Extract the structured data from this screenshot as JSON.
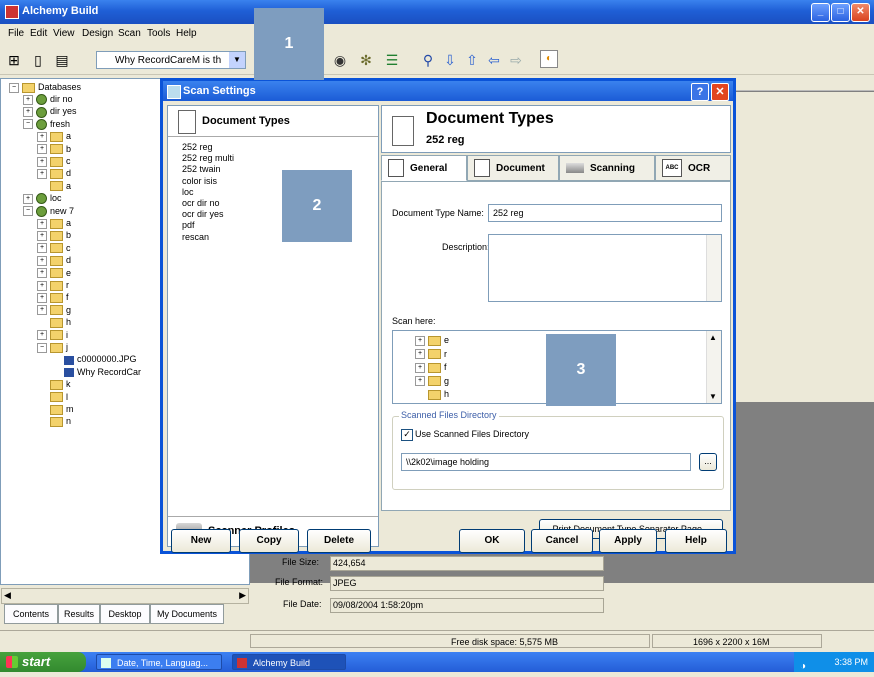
{
  "app": {
    "title": "Alchemy Build",
    "menus": [
      "File",
      "Edit",
      "View",
      "Design",
      "Scan",
      "Tools",
      "Help"
    ],
    "toolbar_combo_value": "Why RecordCareM is th",
    "tree": {
      "root": "Databases",
      "items": [
        {
          "label": "dir no",
          "indent": 1,
          "kind": "db",
          "exp": "+"
        },
        {
          "label": "dir yes",
          "indent": 1,
          "kind": "db",
          "exp": "+"
        },
        {
          "label": "fresh",
          "indent": 1,
          "kind": "db",
          "exp": "−"
        },
        {
          "label": "a",
          "indent": 2,
          "kind": "folder",
          "exp": "+"
        },
        {
          "label": "b",
          "indent": 2,
          "kind": "folder",
          "exp": "+"
        },
        {
          "label": "c",
          "indent": 2,
          "kind": "folder",
          "exp": "+"
        },
        {
          "label": "d",
          "indent": 2,
          "kind": "folder",
          "exp": "+"
        },
        {
          "label": "a",
          "indent": 2,
          "kind": "folder",
          "exp": ""
        },
        {
          "label": "loc",
          "indent": 1,
          "kind": "db",
          "exp": "+"
        },
        {
          "label": "new 7",
          "indent": 1,
          "kind": "db",
          "exp": "−"
        },
        {
          "label": "a",
          "indent": 2,
          "kind": "folder",
          "exp": "+"
        },
        {
          "label": "b",
          "indent": 2,
          "kind": "folder",
          "exp": "+"
        },
        {
          "label": "c",
          "indent": 2,
          "kind": "folder",
          "exp": "+"
        },
        {
          "label": "d",
          "indent": 2,
          "kind": "folder",
          "exp": "+"
        },
        {
          "label": "e",
          "indent": 2,
          "kind": "folder",
          "exp": "+"
        },
        {
          "label": "r",
          "indent": 2,
          "kind": "folder",
          "exp": "+"
        },
        {
          "label": "f",
          "indent": 2,
          "kind": "folder",
          "exp": "+"
        },
        {
          "label": "g",
          "indent": 2,
          "kind": "folder",
          "exp": "+"
        },
        {
          "label": "h",
          "indent": 2,
          "kind": "folder",
          "exp": ""
        },
        {
          "label": "i",
          "indent": 2,
          "kind": "folder",
          "exp": "+"
        },
        {
          "label": "j",
          "indent": 2,
          "kind": "folder",
          "exp": "−"
        },
        {
          "label": "c0000000.JPG",
          "indent": 3,
          "kind": "file",
          "exp": ""
        },
        {
          "label": "Why RecordCar",
          "indent": 3,
          "kind": "file",
          "exp": ""
        },
        {
          "label": "k",
          "indent": 2,
          "kind": "folder",
          "exp": ""
        },
        {
          "label": "l",
          "indent": 2,
          "kind": "folder",
          "exp": ""
        },
        {
          "label": "m",
          "indent": 2,
          "kind": "folder",
          "exp": ""
        },
        {
          "label": "n",
          "indent": 2,
          "kind": "folder",
          "exp": ""
        }
      ]
    },
    "bottom_tabs": [
      "Contents",
      "Results",
      "Desktop",
      "My Documents"
    ],
    "file_props": {
      "file_size_label": "File Size:",
      "file_size_value": "424,654",
      "file_format_label": "File Format:",
      "file_format_value": "JPEG",
      "file_date_label": "File Date:",
      "file_date_value": "09/08/2004 1:58:20pm"
    },
    "status": {
      "free_disk": "Free disk space: 5,575 MB",
      "dimensions": "1696 x 2200 x 16M"
    }
  },
  "taskbar": {
    "start_label": "start",
    "tasks": [
      "Date, Time, Languag...",
      "Alchemy Build"
    ],
    "clock": "3:38 PM"
  },
  "dialog": {
    "title": "Scan Settings",
    "help_glyph": "?",
    "close_glyph": "✕",
    "left_header": "Document Types",
    "document_types": [
      "252 reg",
      "252 reg multi",
      "252 twain",
      "color isis",
      "loc",
      "ocr dir no",
      "ocr dir yes",
      "pdf",
      "rescan"
    ],
    "scanner_profiles": "Scanner Profiles",
    "buttons_left": [
      "New",
      "Copy",
      "Delete"
    ],
    "right_header_title": "Document Types",
    "right_header_sub": "252 reg",
    "tabs": [
      "General",
      "Document",
      "Scanning",
      "OCR"
    ],
    "ocr_badge": "ABC",
    "general": {
      "doc_type_name_label": "Document Type Name:",
      "doc_type_name_value": "252 reg",
      "description_label": "Description:",
      "description_value": "",
      "scan_here_label": "Scan here:",
      "scan_tree": [
        "e",
        "r",
        "f",
        "g",
        "h"
      ],
      "scanned_files_group": "Scanned Files Directory",
      "use_scanned_label": "Use Scanned Files Directory",
      "use_scanned_checked": true,
      "directory_value": "\\\\2k02\\image holding",
      "browse_label": "...",
      "print_separator_label": "Print Document Type Separator Page..."
    },
    "buttons_right": [
      "OK",
      "Cancel",
      "Apply",
      "Help"
    ]
  },
  "markers": [
    "1",
    "2",
    "3"
  ]
}
